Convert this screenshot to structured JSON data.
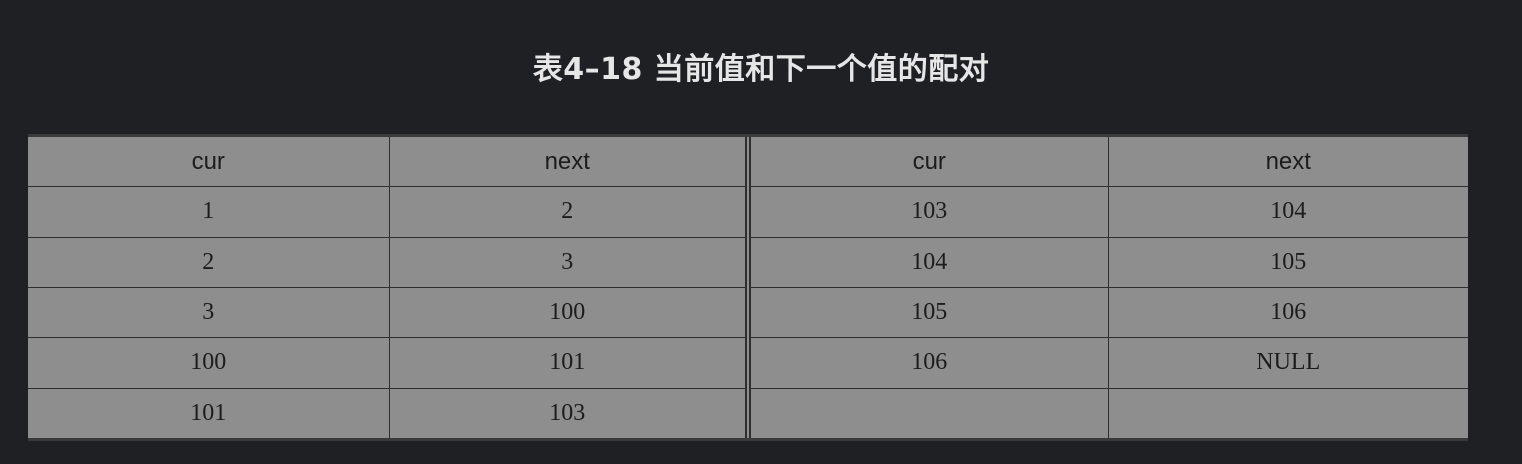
{
  "caption": "表4–18  当前值和下一个值的配对",
  "table": {
    "headers": [
      "cur",
      "next",
      "cur",
      "next"
    ],
    "rows": [
      [
        "1",
        "2",
        "103",
        "104"
      ],
      [
        "2",
        "3",
        "104",
        "105"
      ],
      [
        "3",
        "100",
        "105",
        "106"
      ],
      [
        "100",
        "101",
        "106",
        "NULL"
      ],
      [
        "101",
        "103",
        "",
        ""
      ]
    ]
  },
  "colors": {
    "background": "#1f2023",
    "table_fill": "#8e8e8e",
    "caption_text": "#e6e6e6"
  }
}
